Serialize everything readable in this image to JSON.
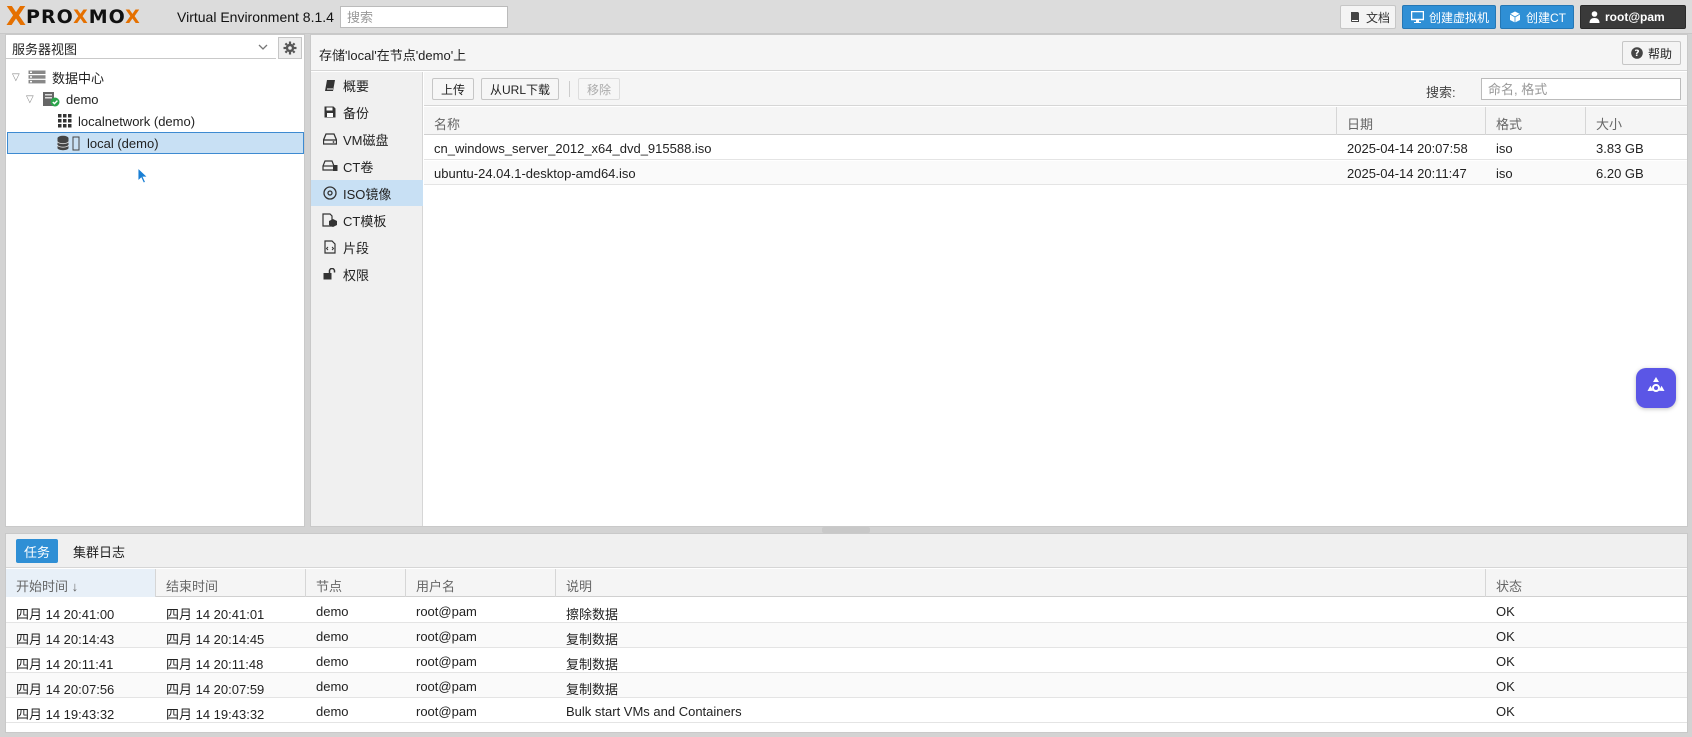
{
  "header": {
    "logo_x": "X",
    "logo_text_a": "PRO",
    "logo_text_x": "X",
    "logo_text_b": "MO",
    "logo_text_c": "X",
    "version": "Virtual Environment 8.1.4",
    "search_placeholder": "搜索",
    "docs_label": "文档",
    "create_vm_label": "创建虚拟机",
    "create_ct_label": "创建CT",
    "user_label": "root@pam"
  },
  "sidebar": {
    "view_label": "服务器视图",
    "tree": [
      {
        "label": "数据中心",
        "level": 0
      },
      {
        "label": "demo",
        "level": 1
      },
      {
        "label": "localnetwork (demo)",
        "level": 2
      },
      {
        "label": "local (demo)",
        "level": 2,
        "selected": true
      }
    ]
  },
  "main": {
    "title": "存储'local'在节点'demo'上",
    "help_label": "帮助",
    "nav": [
      {
        "label": "概要"
      },
      {
        "label": "备份"
      },
      {
        "label": "VM磁盘"
      },
      {
        "label": "CT卷"
      },
      {
        "label": "ISO镜像",
        "active": true
      },
      {
        "label": "CT模板"
      },
      {
        "label": "片段"
      },
      {
        "label": "权限"
      }
    ],
    "toolbar": {
      "upload": "上传",
      "download_url": "从URL下载",
      "remove": "移除",
      "search_label": "搜索:",
      "search_placeholder": "命名, 格式"
    },
    "columns": [
      "名称",
      "日期",
      "格式",
      "大小"
    ],
    "rows": [
      {
        "name": "cn_windows_server_2012_x64_dvd_915588.iso",
        "date": "2025-04-14 20:07:58",
        "format": "iso",
        "size": "3.83 GB"
      },
      {
        "name": "ubuntu-24.04.1-desktop-amd64.iso",
        "date": "2025-04-14 20:11:47",
        "format": "iso",
        "size": "6.20 GB"
      }
    ]
  },
  "tasks": {
    "tabs": [
      "任务",
      "集群日志"
    ],
    "columns": [
      "开始时间 ↓",
      "结束时间",
      "节点",
      "用户名",
      "说明",
      "状态"
    ],
    "rows": [
      {
        "start": "四月 14 20:41:00",
        "end": "四月 14 20:41:01",
        "node": "demo",
        "user": "root@pam",
        "desc": "擦除数据",
        "status": "OK"
      },
      {
        "start": "四月 14 20:14:43",
        "end": "四月 14 20:14:45",
        "node": "demo",
        "user": "root@pam",
        "desc": "复制数据",
        "status": "OK"
      },
      {
        "start": "四月 14 20:11:41",
        "end": "四月 14 20:11:48",
        "node": "demo",
        "user": "root@pam",
        "desc": "复制数据",
        "status": "OK"
      },
      {
        "start": "四月 14 20:07:56",
        "end": "四月 14 20:07:59",
        "node": "demo",
        "user": "root@pam",
        "desc": "复制数据",
        "status": "OK"
      },
      {
        "start": "四月 14 19:43:32",
        "end": "四月 14 19:43:32",
        "node": "demo",
        "user": "root@pam",
        "desc": "Bulk start VMs and Containers",
        "status": "OK"
      }
    ]
  },
  "colors": {
    "accent": "#2f8fd5",
    "brand_orange": "#e57000",
    "selection": "#c8e0f4",
    "user_button": "#3a3a3a",
    "assistant": "#5b56e6"
  },
  "icons": {
    "docs": "book-icon",
    "create_vm": "monitor-icon",
    "create_ct": "cube-icon",
    "user": "user-icon",
    "help": "question-circle-icon",
    "settings": "gear-icon",
    "datacenter": "server-stack-icon",
    "node": "node-ok-icon",
    "network": "grid-icon",
    "storage": "database-icon"
  }
}
